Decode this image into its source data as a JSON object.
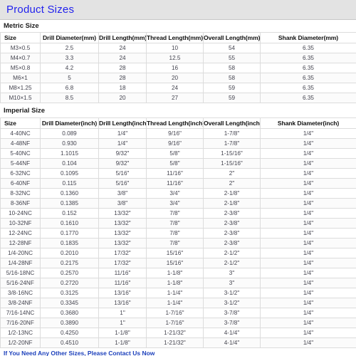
{
  "header": {
    "title": "Product Sizes",
    "title_color": "#2222ee",
    "background_color": "#e3e3e3"
  },
  "metric": {
    "section_title": "Metric Size",
    "columns": [
      "Size",
      "Drill Diameter(mm)",
      "Drill Length(mm)",
      "Thread Length(mm)",
      "Overall Length(mm)",
      "Shank Diameter(mm)"
    ],
    "rows": [
      [
        "M3×0.5",
        "2.5",
        "24",
        "10",
        "54",
        "6.35"
      ],
      [
        "M4×0.7",
        "3.3",
        "24",
        "12.5",
        "55",
        "6.35"
      ],
      [
        "M5×0.8",
        "4.2",
        "28",
        "16",
        "58",
        "6.35"
      ],
      [
        "M6×1",
        "5",
        "28",
        "20",
        "58",
        "6.35"
      ],
      [
        "M8×1.25",
        "6.8",
        "18",
        "24",
        "59",
        "6.35"
      ],
      [
        "M10×1.5",
        "8.5",
        "20",
        "27",
        "59",
        "6.35"
      ]
    ]
  },
  "imperial": {
    "section_title": "Imperial Size",
    "columns": [
      "Size",
      "Drill Diameter(inch)",
      "Drill Length(inch)",
      "Thread Length(inch)",
      "Overall Length(inch)",
      "Shank Diameter(inch)"
    ],
    "rows": [
      [
        "4-40NC",
        "0.089",
        "1/4\"",
        "9/16\"",
        "1-7/8\"",
        "1/4\""
      ],
      [
        "4-48NF",
        "0.930",
        "1/4\"",
        "9/16\"",
        "1-7/8\"",
        "1/4\""
      ],
      [
        "5-40NC",
        "1.1015",
        "9/32\"",
        "5/8\"",
        "1-15/16\"",
        "1/4\""
      ],
      [
        "5-44NF",
        "0.104",
        "9/32\"",
        "5/8\"",
        "1-15/16\"",
        "1/4\""
      ],
      [
        "6-32NC",
        "0.1095",
        "5/16\"",
        "11/16\"",
        "2\"",
        "1/4\""
      ],
      [
        "6-40NF",
        "0.115",
        "5/16\"",
        "11/16\"",
        "2\"",
        "1/4\""
      ],
      [
        "8-32NC",
        "0.1360",
        "3/8\"",
        "3/4\"",
        "2-1/8\"",
        "1/4\""
      ],
      [
        "8-36NF",
        "0.1385",
        "3/8\"",
        "3/4\"",
        "2-1/8\"",
        "1/4\""
      ],
      [
        "10-24NC",
        "0.152",
        "13/32\"",
        "7/8\"",
        "2-3/8\"",
        "1/4\""
      ],
      [
        "10-32NF",
        "0.1610",
        "13/32\"",
        "7/8\"",
        "2-3/8\"",
        "1/4\""
      ],
      [
        "12-24NC",
        "0.1770",
        "13/32\"",
        "7/8\"",
        "2-3/8\"",
        "1/4\""
      ],
      [
        "12-28NF",
        "0.1835",
        "13/32\"",
        "7/8\"",
        "2-3/8\"",
        "1/4\""
      ],
      [
        "1/4-20NC",
        "0.2010",
        "17/32\"",
        "15/16\"",
        "2-1/2\"",
        "1/4\""
      ],
      [
        "1/4-28NF",
        "0.2175",
        "17/32\"",
        "15/16\"",
        "2-1/2\"",
        "1/4\""
      ],
      [
        "5/16-18NC",
        "0.2570",
        "11/16\"",
        "1-1/8\"",
        "3\"",
        "1/4\""
      ],
      [
        "5/16-24NF",
        "0.2720",
        "11/16\"",
        "1-1/8\"",
        "3\"",
        "1/4\""
      ],
      [
        "3/8-16NC",
        "0.3125",
        "13/16\"",
        "1-1/4\"",
        "3-1/2\"",
        "1/4\""
      ],
      [
        "3/8-24NF",
        "0.3345",
        "13/16\"",
        "1-1/4\"",
        "3-1/2\"",
        "1/4\""
      ],
      [
        "7/16-14NC",
        "0.3680",
        "1\"",
        "1-7/16\"",
        "3-7/8\"",
        "1/4\""
      ],
      [
        "7/16-20NF",
        "0.3890",
        "1\"",
        "1-7/16\"",
        "3-7/8\"",
        "1/4\""
      ],
      [
        "1/2-13NC",
        "0.4250",
        "1-1/8\"",
        "1-21/32\"",
        "4-1/4\"",
        "1/4\""
      ],
      [
        "1/2-20NF",
        "0.4510",
        "1-1/8\"",
        "1-21/32\"",
        "4-1/4\"",
        "1/4\""
      ]
    ]
  },
  "footer": {
    "note": "If You Need Any Other Sizes, Please Contact Us Now"
  }
}
